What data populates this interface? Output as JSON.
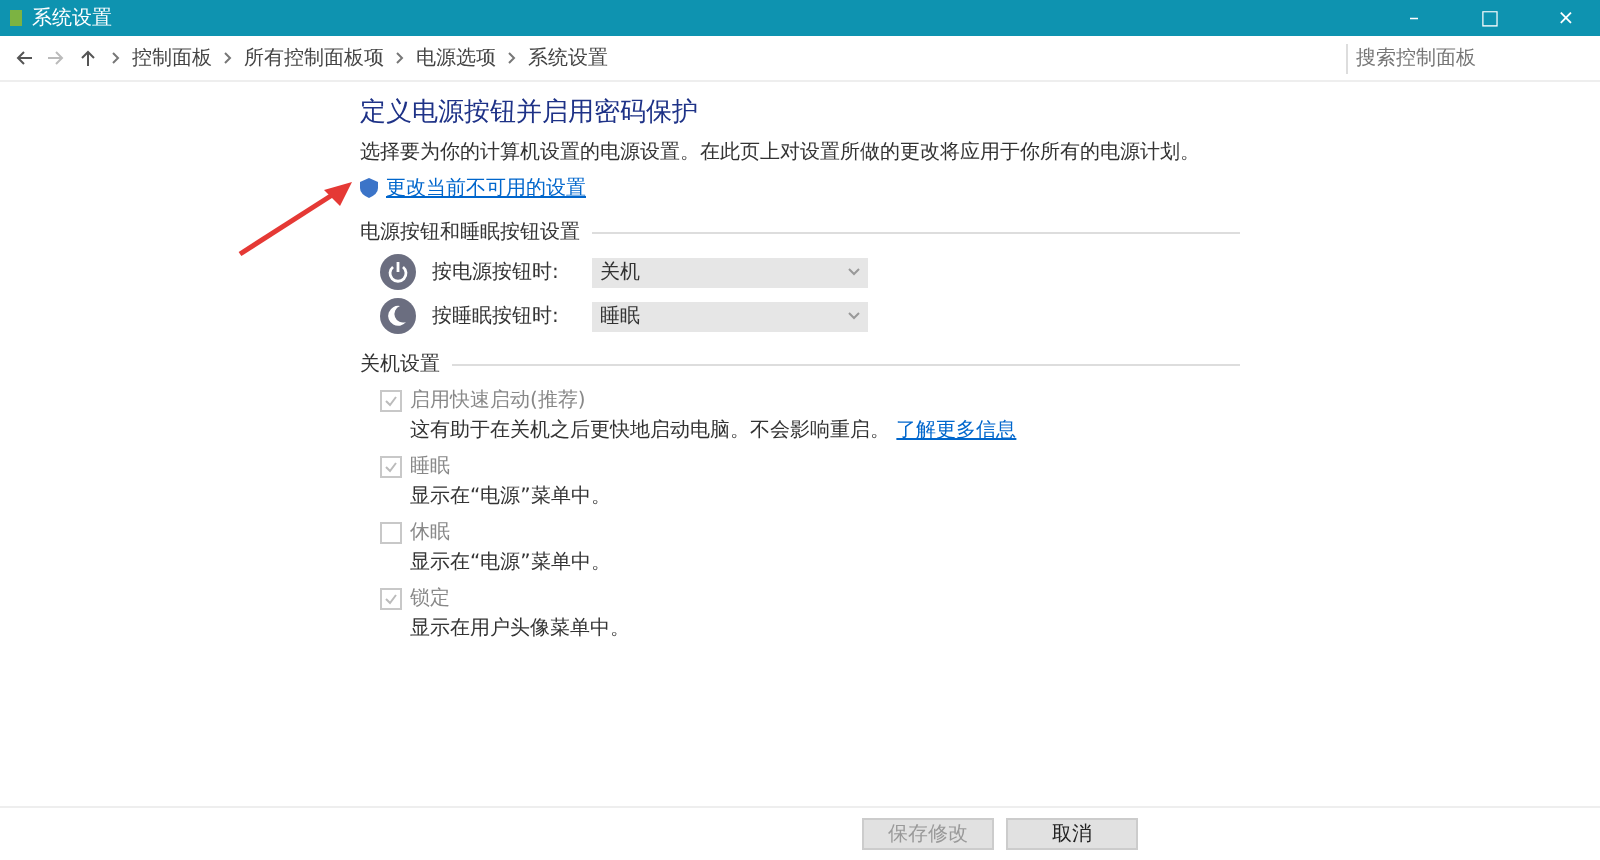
{
  "window": {
    "title": "系统设置",
    "controls": [
      "–",
      "□",
      "×"
    ]
  },
  "breadcrumb": [
    "控制面板",
    "所有控制面板项",
    "电源选项",
    "系统设置"
  ],
  "search": {
    "placeholder": "搜索控制面板"
  },
  "heading": "定义电源按钮并启用密码保护",
  "description": "选择要为你的计算机设置的电源设置。在此页上对设置所做的更改将应用于你所有的电源计划。",
  "change_link": "更改当前不可用的设置",
  "buttons_section": {
    "title": "电源按钮和睡眠按钮设置",
    "rows": [
      {
        "kind": "power",
        "label": "按电源按钮时:",
        "value": "关机"
      },
      {
        "kind": "sleep",
        "label": "按睡眠按钮时:",
        "value": "睡眠"
      }
    ]
  },
  "shutdown_section": {
    "title": "关机设置",
    "options": [
      {
        "label": "启用快速启动(推荐)",
        "description": "这有助于在关机之后更快地启动电脑。不会影响重启。",
        "link": "了解更多信息",
        "checked": true,
        "disabled": true
      },
      {
        "label": "睡眠",
        "description": "显示在“电源”菜单中。",
        "checked": true,
        "disabled": true
      },
      {
        "label": "休眠",
        "description": "显示在“电源”菜单中。",
        "checked": false,
        "disabled": true
      },
      {
        "label": "锁定",
        "description": "显示在用户头像菜单中。",
        "checked": true,
        "disabled": true
      }
    ]
  },
  "footer_buttons": [
    {
      "label": "保存修改",
      "disabled": true
    },
    {
      "label": "取消",
      "disabled": false
    }
  ]
}
